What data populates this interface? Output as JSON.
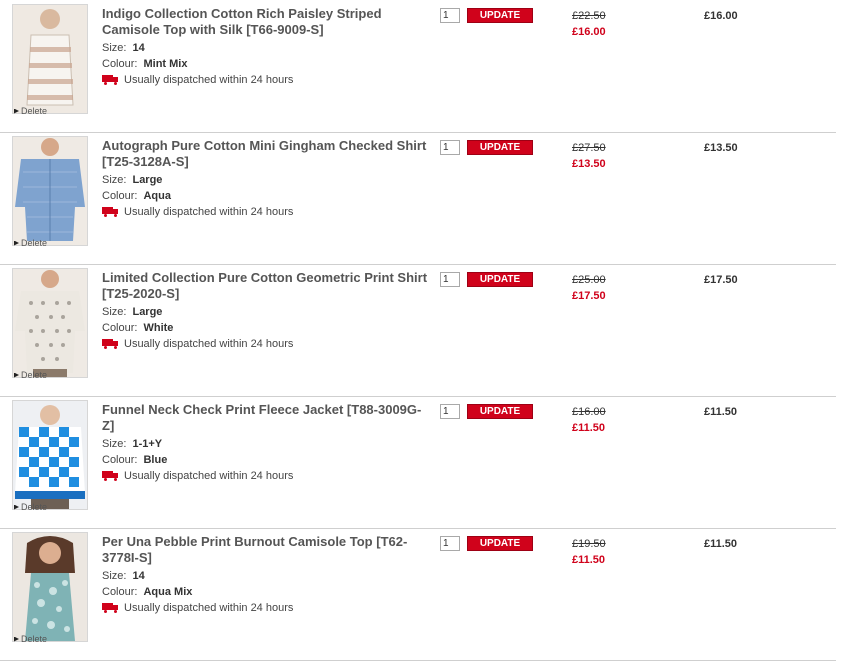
{
  "update_label": "UPDATE",
  "delete_label": "Delete",
  "size_label": "Size:",
  "colour_label": "Colour:",
  "accent_color": "#d0021b",
  "items": [
    {
      "title": "Indigo Collection Cotton Rich Paisley Striped Camisole Top with Silk [T66-9009-S]",
      "size": "14",
      "colour": "Mint Mix",
      "dispatch": "Usually dispatched within 24 hours",
      "qty": "1",
      "was_price": "£22.50",
      "now_price": "£16.00",
      "total": "£16.00",
      "image": "camisole-top-icon"
    },
    {
      "title": "Autograph Pure Cotton Mini Gingham Checked Shirt [T25-3128A-S]",
      "size": "Large",
      "colour": "Aqua",
      "dispatch": "Usually dispatched within 24 hours",
      "qty": "1",
      "was_price": "£27.50",
      "now_price": "£13.50",
      "total": "£13.50",
      "image": "shirt-icon"
    },
    {
      "title": "Limited Collection Pure Cotton Geometric Print Shirt [T25-2020-S]",
      "size": "Large",
      "colour": "White",
      "dispatch": "Usually dispatched within 24 hours",
      "qty": "1",
      "was_price": "£25.00",
      "now_price": "£17.50",
      "total": "£17.50",
      "image": "shirt-icon"
    },
    {
      "title": "Funnel Neck Check Print Fleece Jacket [T88-3009G-Z]",
      "size": "1-1+Y",
      "colour": "Blue",
      "dispatch": "Usually dispatched within 24 hours",
      "qty": "1",
      "was_price": "£16.00",
      "now_price": "£11.50",
      "total": "£11.50",
      "image": "jacket-icon"
    },
    {
      "title": "Per Una Pebble Print Burnout Camisole Top [T62-3778I-S]",
      "size": "14",
      "colour": "Aqua Mix",
      "dispatch": "Usually dispatched within 24 hours",
      "qty": "1",
      "was_price": "£19.50",
      "now_price": "£11.50",
      "total": "£11.50",
      "image": "camisole-top-icon"
    }
  ]
}
